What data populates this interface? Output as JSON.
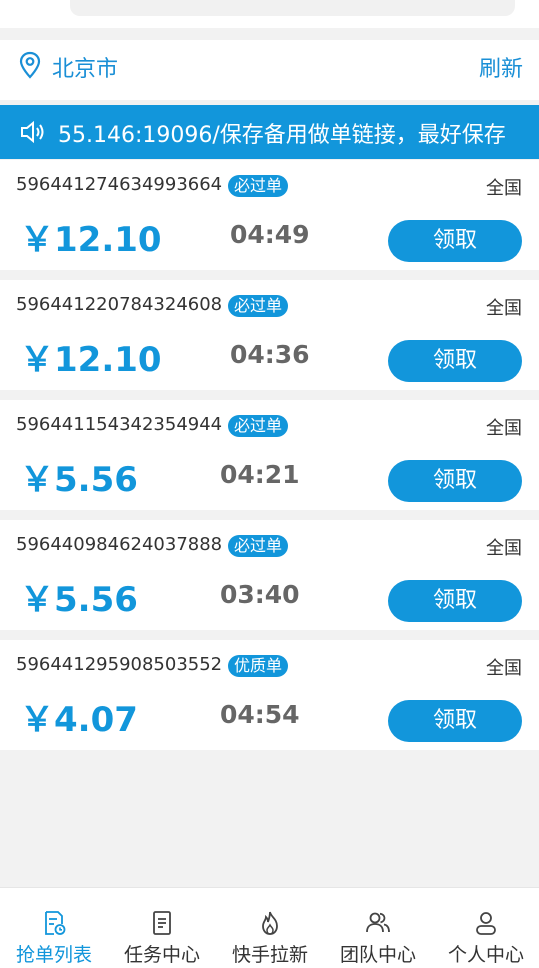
{
  "location": {
    "city": "北京市",
    "refresh_label": "刷新"
  },
  "notice": {
    "text": "55.146:19096/保存备用做单链接，最好保存"
  },
  "orders": [
    {
      "id": "596441274634993664",
      "badge": "必过单",
      "region": "全国",
      "price": "￥12.10",
      "time": "04:49",
      "action": "领取"
    },
    {
      "id": "596441220784324608",
      "badge": "必过单",
      "region": "全国",
      "price": "￥12.10",
      "time": "04:36",
      "action": "领取"
    },
    {
      "id": "596441154342354944",
      "badge": "必过单",
      "region": "全国",
      "price": "￥5.56",
      "time": "04:21",
      "action": "领取"
    },
    {
      "id": "596440984624037888",
      "badge": "必过单",
      "region": "全国",
      "price": "￥5.56",
      "time": "03:40",
      "action": "领取"
    },
    {
      "id": "596441295908503552",
      "badge": "优质单",
      "region": "全国",
      "price": "￥4.07",
      "time": "04:54",
      "action": "领取"
    }
  ],
  "tabs": [
    {
      "label": "抢单列表",
      "icon": "order-list-icon",
      "active": true
    },
    {
      "label": "任务中心",
      "icon": "task-doc-icon",
      "active": false
    },
    {
      "label": "快手拉新",
      "icon": "flame-icon",
      "active": false
    },
    {
      "label": "团队中心",
      "icon": "team-icon",
      "active": false
    },
    {
      "label": "个人中心",
      "icon": "person-icon",
      "active": false
    }
  ],
  "colors": {
    "accent": "#1296db",
    "background": "#f2f2f2",
    "time_text": "#666666"
  }
}
